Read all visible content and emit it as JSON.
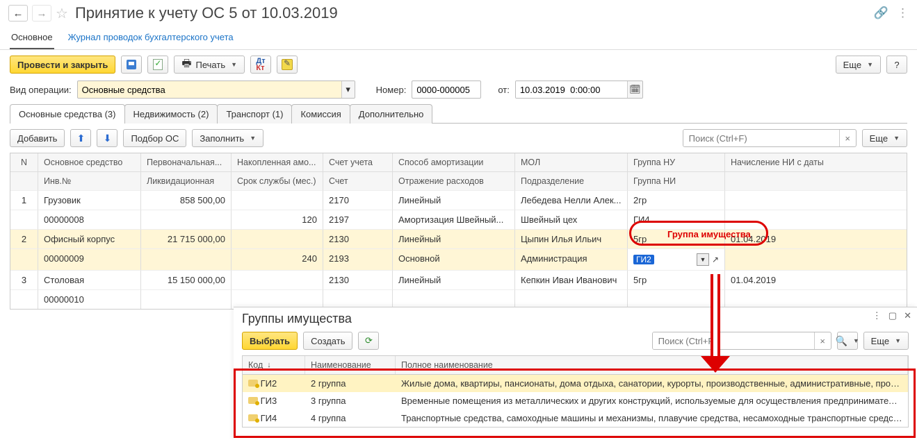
{
  "header": {
    "title": "Принятие к учету ОС 5 от 10.03.2019"
  },
  "navTabs": {
    "main": "Основное",
    "journal": "Журнал проводок бухгалтерского учета"
  },
  "toolbar": {
    "postAndClose": "Провести и закрыть",
    "print": "Печать",
    "more": "Еще",
    "help": "?"
  },
  "form": {
    "opTypeLabel": "Вид операции:",
    "opTypeValue": "Основные средства",
    "numberLabel": "Номер:",
    "numberValue": "0000-000005",
    "fromLabel": "от:",
    "dateValue": "10.03.2019  0:00:00"
  },
  "tabs2": {
    "fixedAssets": "Основные средства (3)",
    "realty": "Недвижимость (2)",
    "transport": "Транспорт (1)",
    "commission": "Комиссия",
    "additional": "Дополнительно"
  },
  "tableToolbar": {
    "add": "Добавить",
    "pick": "Подбор ОС",
    "fill": "Заполнить",
    "searchPlaceholder": "Поиск (Ctrl+F)",
    "more": "Еще"
  },
  "gridHeaders": {
    "n": "N",
    "os": "Основное средство",
    "inv": "Инв.№",
    "pv": "Первоначальная...",
    "liq": "Ликвидационная",
    "na": "Накопленная амо...",
    "life": "Срок службы (мес.)",
    "acct": "Счет учета",
    "acct2": "Счет",
    "amort": "Способ амортизации",
    "expenses": "Отражение расходов",
    "mol": "МОЛ",
    "dept": "Подразделение",
    "gnu": "Группа НУ",
    "gni": "Группа НИ",
    "ni": "Начисление НИ с даты"
  },
  "rows": [
    {
      "n": "1",
      "os": "Грузовик",
      "inv": "00000008",
      "pv": "858 500,00",
      "life": "120",
      "acct": "2170",
      "acct2": "2197",
      "amort": "Линейный",
      "expenses": "Амортизация Швейный...",
      "mol": "Лебедева Нелли Алек...",
      "dept": "Швейный цех",
      "gnu": "2гр",
      "gni": "ГИ4",
      "ni": ""
    },
    {
      "n": "2",
      "os": "Офисный корпус",
      "inv": "00000009",
      "pv": "21 715 000,00",
      "life": "240",
      "acct": "2130",
      "acct2": "2193",
      "amort": "Линейный",
      "expenses": "Основной",
      "mol": "Цыпин Илья Ильич",
      "dept": "Администрация",
      "gnu": "5гр",
      "gni": "ГИ2",
      "ni": "01.04.2019"
    },
    {
      "n": "3",
      "os": "Столовая",
      "inv": "00000010",
      "pv": "15 150 000,00",
      "life": "",
      "acct": "2130",
      "acct2": "",
      "amort": "Линейный",
      "expenses": "",
      "mol": "Кепкин Иван Иванович",
      "dept": "",
      "gnu": "5гр",
      "gni": "",
      "ni": "01.04.2019"
    }
  ],
  "callout": {
    "label": "Группа имущества"
  },
  "popup": {
    "title": "Группы имущества",
    "select": "Выбрать",
    "create": "Создать",
    "searchPlaceholder": "Поиск (Ctrl+F)",
    "more": "Еще",
    "headers": {
      "code": "Код",
      "name": "Наименование",
      "full": "Полное наименование"
    },
    "rows": [
      {
        "code": "ГИ2",
        "name": "2 группа",
        "full": "Жилые дома, квартиры, пансионаты, дома отдыха, санатории, курорты, производственные, административные, промыш..."
      },
      {
        "code": "ГИ3",
        "name": "3 группа",
        "full": "Временные помещения из металлических и других конструкций, используемые для осуществления предпринимательск..."
      },
      {
        "code": "ГИ4",
        "name": "4 группа",
        "full": "Транспортные средства, самоходные машины и механизмы, плавучие средства, несамоходные транспортные средства ..."
      }
    ]
  }
}
